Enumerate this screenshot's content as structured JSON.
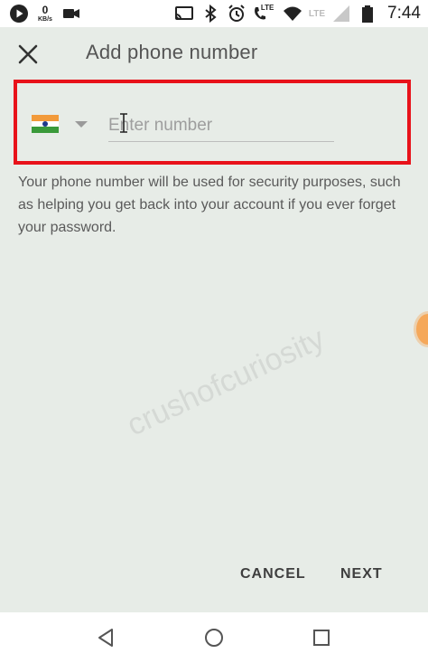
{
  "status_bar": {
    "network_speed_value": "0",
    "network_speed_unit": "KB/s",
    "lte_label_1": "LTE",
    "lte_label_2": "LTE",
    "time": "7:44"
  },
  "header": {
    "title": "Add phone number",
    "close_icon": "close-icon"
  },
  "phone_field": {
    "country_flag": "india-flag-icon",
    "placeholder": "Enter number",
    "value": ""
  },
  "info_text": "Your phone number will be used for security purposes, such as helping you get back into your account if you ever forget your password.",
  "watermark": "crushofcuriosity",
  "actions": {
    "cancel_label": "CANCEL",
    "next_label": "NEXT"
  },
  "nav_bar": {
    "back_icon": "back-triangle-icon",
    "home_icon": "home-circle-icon",
    "recents_icon": "recents-square-icon"
  },
  "colors": {
    "background": "#e7ece7",
    "highlight_border": "#e8121a",
    "title_text": "#555555",
    "button_text": "#3e3e3e"
  }
}
